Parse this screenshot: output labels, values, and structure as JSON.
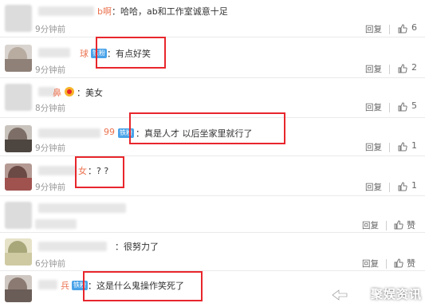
{
  "comments": [
    {
      "name": "b啊",
      "badge": "",
      "text": "：哈哈，ab和工作室诚意十足",
      "time": "9分钟前",
      "reply": "回复",
      "likes": "6"
    },
    {
      "name": "球",
      "badge": "铁粉",
      "text": "：有点好笑",
      "time": "9分钟前",
      "reply": "回复",
      "likes": "2"
    },
    {
      "name": "鼻",
      "badge": "",
      "text": "：美女",
      "time": "8分钟前",
      "reply": "回复",
      "likes": "5"
    },
    {
      "name": "99",
      "badge": "铁粉",
      "text": "：真是人才 以后坐家里就行了",
      "time": "9分钟前",
      "reply": "回复",
      "likes": "1"
    },
    {
      "name": "女",
      "badge": "",
      "text": "：? ?",
      "time": "9分钟前",
      "reply": "回复",
      "likes": "1"
    },
    {
      "name": "",
      "badge": "",
      "text": "",
      "time": "",
      "reply": "回复",
      "likes": "赞"
    },
    {
      "name": "",
      "badge": "",
      "text": "：很努力了",
      "time": "6分钟前",
      "reply": "回复",
      "likes": "赞"
    },
    {
      "name": "兵",
      "badge": "铁粉",
      "text": "：这是什么鬼操作笑死了",
      "time": "",
      "reply": "",
      "likes": ""
    }
  ],
  "watermark": "聚娱资讯",
  "colors": {
    "name": "#eb7350",
    "badge": "#4aa3e8",
    "highlight": "#e8262c"
  },
  "icons": {
    "like": "thumbs-up-icon",
    "avatar": "avatar-icon"
  }
}
